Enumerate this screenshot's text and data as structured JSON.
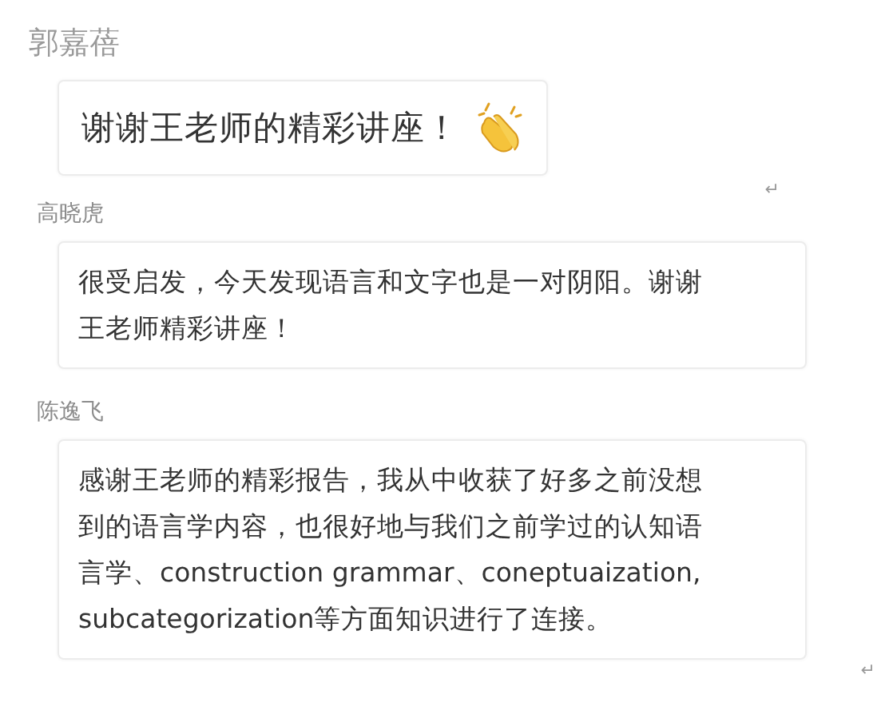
{
  "messages": [
    {
      "kind": "large",
      "sender": "郭嘉蓓",
      "lines": [
        "谢谢王老师的精彩讲座！"
      ],
      "trailing_mark": "↵"
    },
    {
      "kind": "normal",
      "sender": "高晓虎",
      "lines": [
        "很受启发，今天发现语言和文字也是一对阴阳。谢谢",
        "王老师精彩讲座！"
      ]
    },
    {
      "kind": "normal",
      "sender": "陈逸飞",
      "lines": [
        "感谢王老师的精彩报告，我从中收获了好多之前没想",
        "到的语言学内容，也很好地与我们之前学过的认知语",
        "言学、construction grammar、coneptuaization,",
        "subcategorization等方面知识进行了连接。"
      ],
      "trailing_mark": "↵"
    }
  ]
}
